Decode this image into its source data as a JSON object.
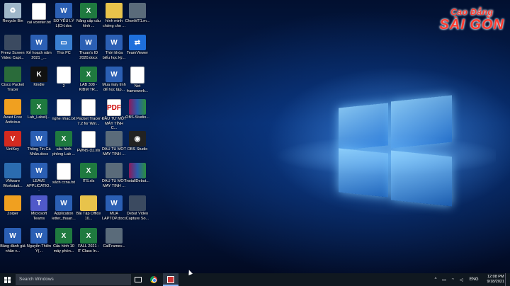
{
  "brand": {
    "line1": "Cao Đẳng",
    "line2": "SÀI GÒN",
    "color": "#ff3a2f"
  },
  "desktop_icons": [
    {
      "label": "Recycle Bin",
      "icon": "recycle-bin-icon"
    },
    {
      "label": "cai vcenter.txt",
      "icon": "text-file-icon"
    },
    {
      "label": "SƠ YẾU LÝ LỊCH.doc",
      "icon": "word-doc-icon"
    },
    {
      "label": "Nâng cấp cấu hình ...",
      "icon": "excel-file-icon"
    },
    {
      "label": "hình minh chứng cho ...",
      "icon": "folder-icon"
    },
    {
      "label": "ChonMT1.m...",
      "icon": "video-file-icon"
    },
    {
      "label": "Freez Screen Video Capt...",
      "icon": "screen-capture-icon"
    },
    {
      "label": "Kế hoạch năm 2021 _...",
      "icon": "word-doc-icon"
    },
    {
      "label": "This PC",
      "icon": "this-pc-icon"
    },
    {
      "label": "Thuan's ID 2020.docx",
      "icon": "word-doc-icon"
    },
    {
      "label": "Thời khóa biểu học kỳ...",
      "icon": "word-doc-icon"
    },
    {
      "label": "TeamViewer",
      "icon": "teamviewer-icon"
    },
    {
      "label": "Cisco Packet Tracer",
      "icon": "cisco-icon"
    },
    {
      "label": "Kindle",
      "icon": "kindle-icon"
    },
    {
      "label": "2",
      "icon": "blank-file-icon"
    },
    {
      "label": "LAB 308 - KIBM TR...",
      "icon": "excel-file-icon"
    },
    {
      "label": "Mua máy tính để học tập...",
      "icon": "word-doc-icon"
    },
    {
      "label": "Net framework...",
      "icon": "text-file-icon"
    },
    {
      "label": "Avast Free Antivirus",
      "icon": "avast-icon"
    },
    {
      "label": "Lab_Label(...",
      "icon": "excel-file-icon"
    },
    {
      "label": "nghe nhac.txt",
      "icon": "text-file-icon"
    },
    {
      "label": "Packet Tracer 7.2 for Win...",
      "icon": "text-file-icon"
    },
    {
      "label": "ĐẦU TƯ MỘT MÁY TÍNH C...",
      "icon": "pdf-file-icon"
    },
    {
      "label": "OBS-Studio...",
      "icon": "rar-archive-icon"
    },
    {
      "label": "UniKey",
      "icon": "unikey-icon"
    },
    {
      "label": "Thông Tin Cá Nhân.docx",
      "icon": "word-doc-icon"
    },
    {
      "label": "cấu hình phòng Lab ...",
      "icon": "excel-file-icon"
    },
    {
      "label": "FWNS (1).xls",
      "icon": "text-file-icon"
    },
    {
      "label": "DAU TU MOT MAY TINH ...",
      "icon": "video-file-icon"
    },
    {
      "label": "OBS Studio",
      "icon": "obs-icon"
    },
    {
      "label": "VMware Workstati...",
      "icon": "vmware-icon"
    },
    {
      "label": "LEAVE APPLICATIO...",
      "icon": "word-doc-icon"
    },
    {
      "label": "sách ccna.txt",
      "icon": "text-file-icon"
    },
    {
      "label": "ITS.xls",
      "icon": "excel-file-icon"
    },
    {
      "label": "DAU TU MOT MAY TINH ...",
      "icon": "video-file-icon"
    },
    {
      "label": "InstallDebut...",
      "icon": "rar-archive-icon"
    },
    {
      "label": "Zoiper",
      "icon": "zoiper-icon"
    },
    {
      "label": "Microsoft Teams",
      "icon": "teams-icon"
    },
    {
      "label": "Application letter_thuan...",
      "icon": "word-doc-icon"
    },
    {
      "label": "Bài Tập Office 10...",
      "icon": "folder-icon"
    },
    {
      "label": "MUA LAPTOP.docx",
      "icon": "word-doc-icon"
    },
    {
      "label": "Debut Video Capture So...",
      "icon": "debut-icon"
    },
    {
      "label": "Bảng đánh giá nhân v...",
      "icon": "word-doc-icon"
    },
    {
      "label": "Nguyễn Thiên Ý(...",
      "icon": "word-doc-icon"
    },
    {
      "label": "Cấu hình 10 máy phòn...",
      "icon": "excel-file-icon"
    },
    {
      "label": "FALL 2021 - IT Class In...",
      "icon": "excel-file-icon"
    },
    {
      "label": "CalFramev...",
      "icon": "video-file-icon"
    }
  ],
  "taskbar": {
    "search_placeholder": "Search Windows",
    "language": "ENG",
    "time": "12:08 PM",
    "date": "9/18/2021"
  }
}
